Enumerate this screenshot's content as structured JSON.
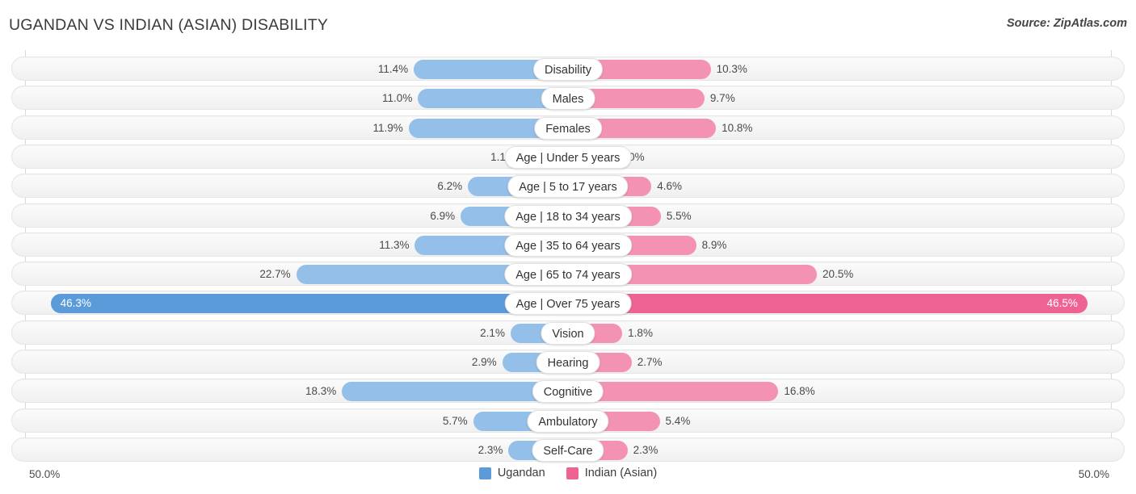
{
  "header": {
    "title": "UGANDAN VS INDIAN (ASIAN) DISABILITY",
    "source": "Source: ZipAtlas.com"
  },
  "axis": {
    "left_label": "50.0%",
    "right_label": "50.0%",
    "max": 50.0
  },
  "legend": {
    "items": [
      {
        "label": "Ugandan",
        "color": "#5b9bd9"
      },
      {
        "label": "Indian (Asian)",
        "color": "#ef6394"
      }
    ]
  },
  "colors": {
    "left_bar": "#93bfe8",
    "right_bar": "#f492b4",
    "left_bar_highlight": "#5b9bd9",
    "right_bar_highlight": "#ef6394",
    "row_track": "#f6f6f6",
    "gridline": "#d8d8d8"
  },
  "chart_data": {
    "type": "bar",
    "orientation": "horizontal-diverging",
    "title": "UGANDAN VS INDIAN (ASIAN) DISABILITY",
    "xlabel": "",
    "ylabel": "",
    "xlim": [
      50.0,
      50.0
    ],
    "grid": true,
    "legend_position": "bottom-center",
    "categories": [
      "Disability",
      "Males",
      "Females",
      "Age | Under 5 years",
      "Age | 5 to 17 years",
      "Age | 18 to 34 years",
      "Age | 35 to 64 years",
      "Age | 65 to 74 years",
      "Age | Over 75 years",
      "Vision",
      "Hearing",
      "Cognitive",
      "Ambulatory",
      "Self-Care"
    ],
    "series": [
      {
        "name": "Ugandan",
        "color": "#93bfe8",
        "values": [
          11.4,
          11.0,
          11.9,
          1.1,
          6.2,
          6.9,
          11.3,
          22.7,
          46.3,
          2.1,
          2.9,
          18.3,
          5.7,
          2.3
        ],
        "labels": [
          "11.4%",
          "11.0%",
          "11.9%",
          "1.1%",
          "6.2%",
          "6.9%",
          "11.3%",
          "22.7%",
          "46.3%",
          "2.1%",
          "2.9%",
          "18.3%",
          "5.7%",
          "2.3%"
        ]
      },
      {
        "name": "Indian (Asian)",
        "color": "#f492b4",
        "values": [
          10.3,
          9.7,
          10.8,
          1.0,
          4.6,
          5.5,
          8.9,
          20.5,
          46.5,
          1.8,
          2.7,
          16.8,
          5.4,
          2.3
        ],
        "labels": [
          "10.3%",
          "9.7%",
          "10.8%",
          "1.0%",
          "4.6%",
          "5.5%",
          "8.9%",
          "20.5%",
          "46.5%",
          "1.8%",
          "2.7%",
          "16.8%",
          "5.4%",
          "2.3%"
        ]
      }
    ],
    "highlighted_rows": [
      8
    ]
  },
  "rows": [
    {
      "label": "Disability",
      "left": "11.4%",
      "right": "10.3%",
      "lv": 11.4,
      "rv": 10.3,
      "hl": false
    },
    {
      "label": "Males",
      "left": "11.0%",
      "right": "9.7%",
      "lv": 11.0,
      "rv": 9.7,
      "hl": false
    },
    {
      "label": "Females",
      "left": "11.9%",
      "right": "10.8%",
      "lv": 11.9,
      "rv": 10.8,
      "hl": false
    },
    {
      "label": "Age | Under 5 years",
      "left": "1.1%",
      "right": "1.0%",
      "lv": 1.1,
      "rv": 1.0,
      "hl": false
    },
    {
      "label": "Age | 5 to 17 years",
      "left": "6.2%",
      "right": "4.6%",
      "lv": 6.2,
      "rv": 4.6,
      "hl": false
    },
    {
      "label": "Age | 18 to 34 years",
      "left": "6.9%",
      "right": "5.5%",
      "lv": 6.9,
      "rv": 5.5,
      "hl": false
    },
    {
      "label": "Age | 35 to 64 years",
      "left": "11.3%",
      "right": "8.9%",
      "lv": 11.3,
      "rv": 8.9,
      "hl": false
    },
    {
      "label": "Age | 65 to 74 years",
      "left": "22.7%",
      "right": "20.5%",
      "lv": 22.7,
      "rv": 20.5,
      "hl": false
    },
    {
      "label": "Age | Over 75 years",
      "left": "46.3%",
      "right": "46.5%",
      "lv": 46.3,
      "rv": 46.5,
      "hl": true
    },
    {
      "label": "Vision",
      "left": "2.1%",
      "right": "1.8%",
      "lv": 2.1,
      "rv": 1.8,
      "hl": false
    },
    {
      "label": "Hearing",
      "left": "2.9%",
      "right": "2.7%",
      "lv": 2.9,
      "rv": 2.7,
      "hl": false
    },
    {
      "label": "Cognitive",
      "left": "18.3%",
      "right": "16.8%",
      "lv": 18.3,
      "rv": 16.8,
      "hl": false
    },
    {
      "label": "Ambulatory",
      "left": "5.7%",
      "right": "5.4%",
      "lv": 5.7,
      "rv": 5.4,
      "hl": false
    },
    {
      "label": "Self-Care",
      "left": "2.3%",
      "right": "2.3%",
      "lv": 2.3,
      "rv": 2.3,
      "hl": false
    }
  ]
}
